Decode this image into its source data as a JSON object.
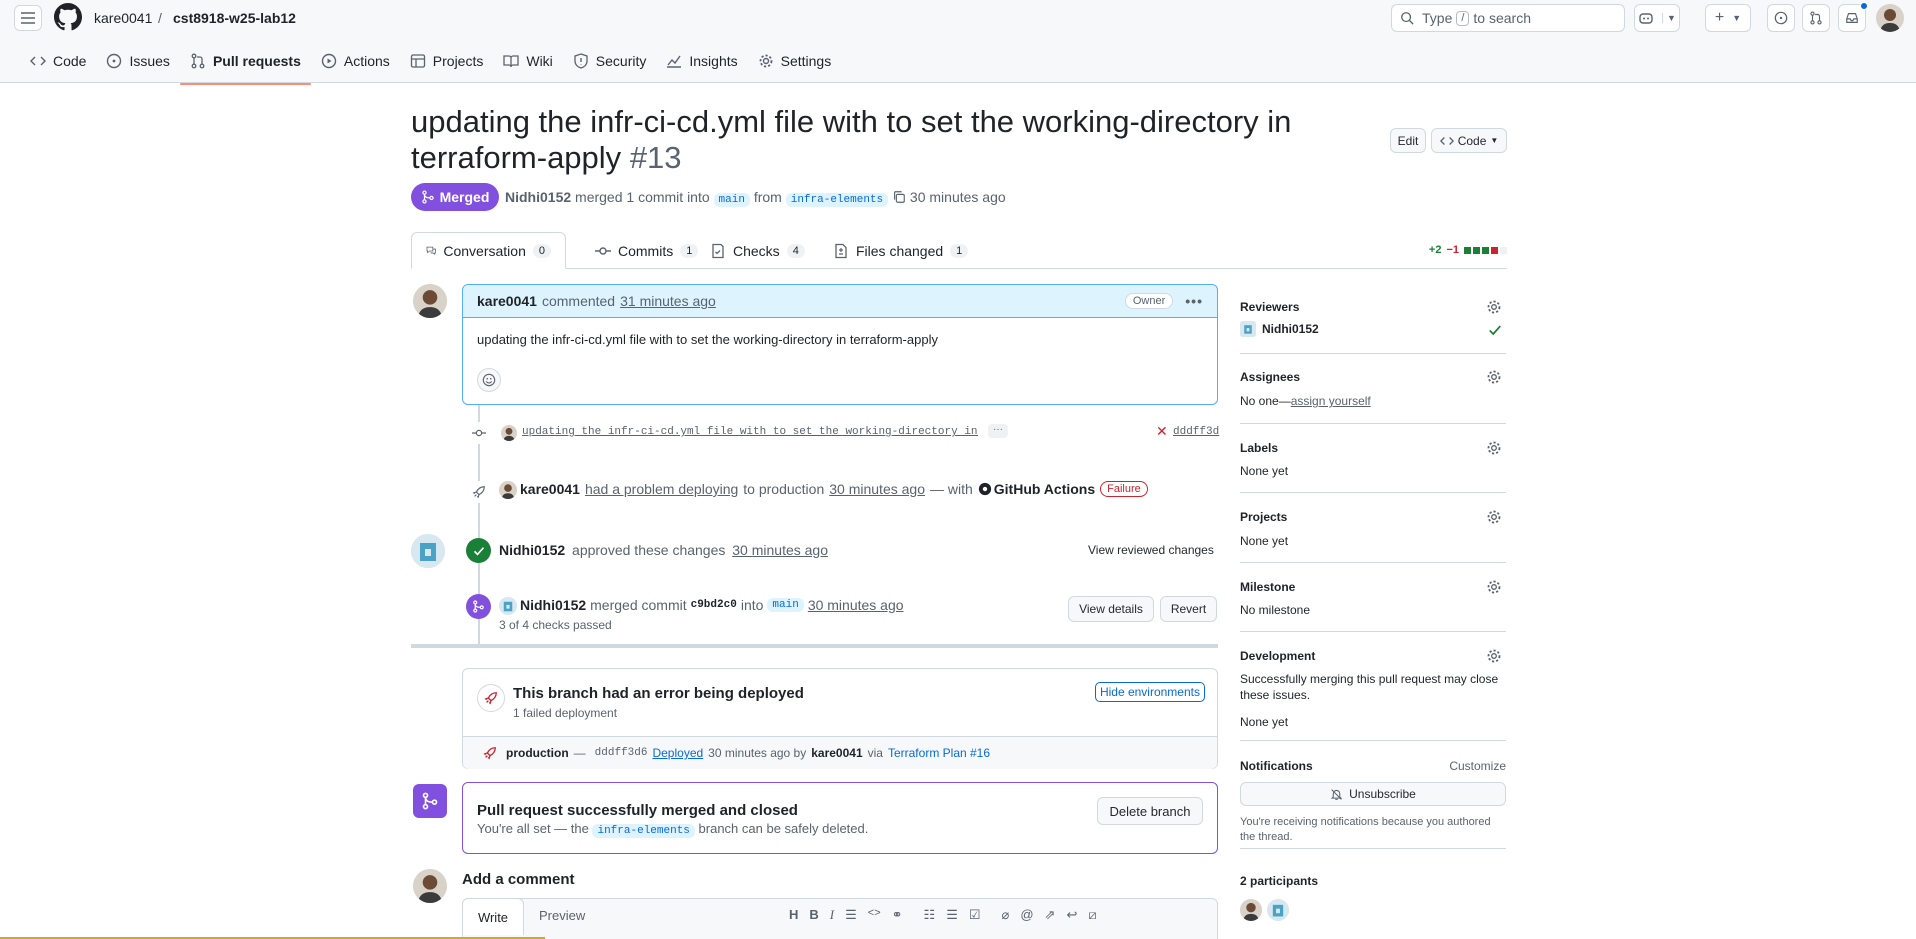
{
  "header": {
    "owner": "kare0041",
    "separator": "/",
    "repo": "cst8918-w25-lab12",
    "search_type": "Type",
    "search_key": "/",
    "search_rest": "to search"
  },
  "repo_nav": [
    {
      "label": "Code",
      "icon": "code-icon"
    },
    {
      "label": "Issues",
      "icon": "issue-opened-icon"
    },
    {
      "label": "Pull requests",
      "icon": "git-pull-request-icon"
    },
    {
      "label": "Actions",
      "icon": "play-icon"
    },
    {
      "label": "Projects",
      "icon": "table-icon"
    },
    {
      "label": "Wiki",
      "icon": "book-icon"
    },
    {
      "label": "Security",
      "icon": "shield-icon"
    },
    {
      "label": "Insights",
      "icon": "graph-icon"
    },
    {
      "label": "Settings",
      "icon": "gear-icon"
    }
  ],
  "pr": {
    "title": "updating the infr-ci-cd.yml file with to set the working-directory in terraform-apply",
    "number": "#13",
    "edit_label": "Edit",
    "code_label": "Code",
    "state": "Merged",
    "author": "Nidhi0152",
    "merged_text": "merged 1 commit into",
    "base": "main",
    "from_text": "from",
    "head": "infra-elements",
    "time": "30 minutes ago"
  },
  "tabs": [
    {
      "label": "Conversation",
      "count": "0"
    },
    {
      "label": "Commits",
      "count": "1"
    },
    {
      "label": "Checks",
      "count": "4"
    },
    {
      "label": "Files changed",
      "count": "1"
    }
  ],
  "diffstat": {
    "added": "+2",
    "removed": "−1"
  },
  "comment": {
    "author": "kare0041",
    "action": "commented",
    "time": "31 minutes ago",
    "badge": "Owner",
    "body": "updating the infr-ci-cd.yml file with to set the working-directory in terraform-apply"
  },
  "timeline": {
    "commit_msg": "updating the infr-ci-cd.yml file with to set the working-directory in…",
    "commit_sha": "dddff3d",
    "deploy_user": "kare0041",
    "deploy_text": "had a problem deploying",
    "deploy_to": "to production",
    "deploy_time": "30 minutes ago",
    "deploy_with": "— with",
    "deploy_app": "GitHub Actions",
    "deploy_status": "Failure",
    "approve_user": "Nidhi0152",
    "approve_text": "approved these changes",
    "approve_time": "30 minutes ago",
    "view_reviewed": "View reviewed changes",
    "merge_user": "Nidhi0152",
    "merge_text": "merged commit",
    "merge_sha": "c9bd2c0",
    "merge_into": "into",
    "merge_branch": "main",
    "merge_time": "30 minutes ago",
    "checks": "3 of 4 checks passed",
    "view_details": "View details",
    "revert": "Revert"
  },
  "deploy_box": {
    "title": "This branch had an error being deployed",
    "subtitle": "1 failed deployment",
    "hide_label": "Hide environments",
    "env": "production",
    "dash": "—",
    "sha": "dddff3d6",
    "deployed": "Deployed",
    "time": "30 minutes ago by",
    "user": "kare0041",
    "via": "via",
    "workflow": "Terraform Plan #16"
  },
  "merged_box": {
    "title": "Pull request successfully merged and closed",
    "text_a": "You're all set — the",
    "branch": "infra-elements",
    "text_b": "branch can be safely deleted.",
    "delete_label": "Delete branch"
  },
  "add_comment": {
    "title": "Add a comment",
    "write": "Write",
    "preview": "Preview"
  },
  "sidebar": {
    "reviewers_title": "Reviewers",
    "reviewer": "Nidhi0152",
    "assignees_title": "Assignees",
    "assignees_none": "No one—",
    "assign_yourself": "assign yourself",
    "labels_title": "Labels",
    "labels_val": "None yet",
    "projects_title": "Projects",
    "projects_val": "None yet",
    "milestone_title": "Milestone",
    "milestone_val": "No milestone",
    "dev_title": "Development",
    "dev_text": "Successfully merging this pull request may close these issues.",
    "dev_val": "None yet",
    "notif_title": "Notifications",
    "customize": "Customize",
    "unsubscribe": "Unsubscribe",
    "notif_text": "You're receiving notifications because you authored the thread.",
    "participants": "2 participants"
  },
  "colors": {
    "merged": "#8250df",
    "success": "#1a7f37",
    "danger": "#cf222e",
    "accent": "#0969da"
  }
}
